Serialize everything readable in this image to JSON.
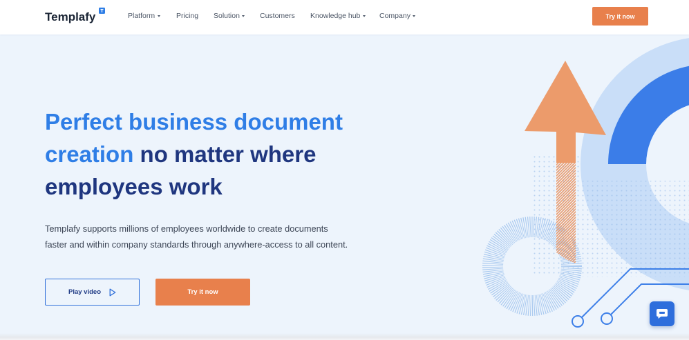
{
  "logo": {
    "text": "Templafy",
    "badge_icon": "templafy-badge-icon"
  },
  "nav": {
    "items": [
      {
        "label": "Platform",
        "has_dropdown": true
      },
      {
        "label": "Pricing",
        "has_dropdown": false
      },
      {
        "label": "Solution",
        "has_dropdown": true
      },
      {
        "label": "Customers",
        "has_dropdown": false
      },
      {
        "label": "Knowledge hub",
        "has_dropdown": true
      },
      {
        "label": "Company",
        "has_dropdown": true
      }
    ],
    "dropdown_icon": "chevron-down-icon",
    "cta_label": "Try it now"
  },
  "hero": {
    "headline": {
      "line1_highlight": "Perfect business document",
      "line2_highlight": "creation",
      "line2_rest": "no matter where",
      "line3": "employees work"
    },
    "description_lines": [
      "Templafy supports millions of employees worldwide to create documents",
      "faster and within company standards through anywhere-access to all content."
    ],
    "play_video_label": "Play video",
    "play_icon": "play-icon",
    "cta_label": "Try it now"
  },
  "chat_widget": {
    "icon": "chat-bubble-icon"
  },
  "colors": {
    "brand_blue": "#2f7ee6",
    "navy": "#1f367f",
    "accent_orange": "#e8804c",
    "hero_background": "#edf4fc"
  }
}
